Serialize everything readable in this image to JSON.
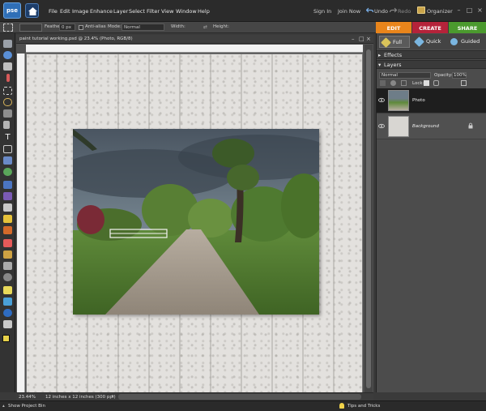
{
  "app": {
    "logo": "pse",
    "menus": [
      "File",
      "Edit",
      "Image",
      "Enhance",
      "Layer",
      "Select",
      "Filter",
      "View",
      "Window",
      "Help"
    ],
    "sign_in": "Sign In",
    "join_now": "Join Now",
    "undo": "Undo",
    "redo": "Redo",
    "organizer": "Organizer"
  },
  "options_bar": {
    "feather_label": "Feather:",
    "feather_value": "0 px",
    "antialias_label": "Anti-alias",
    "mode_label": "Mode:",
    "mode_value": "Normal",
    "width_label": "Width:",
    "height_label": "Height:"
  },
  "mode_tabs": {
    "edit": "EDIT",
    "create": "CREATE",
    "share": "SHARE"
  },
  "colors": {
    "edit": "#e9851b",
    "create": "#b5233a",
    "share": "#4b9a2e",
    "selected_layer": "#1e1e1e"
  },
  "document": {
    "title": "paint tutorial working.psd @ 23.4% (Photo, RGB/8)",
    "zoom": "23.44%",
    "doc_size": "12 inches x 12 inches (300 ppi)"
  },
  "panel": {
    "tabs": [
      "Full",
      "Quick",
      "Guided"
    ],
    "effects_header": "Effects",
    "layers_header": "Layers",
    "blend_mode": "Normal",
    "opacity_label": "Opacity:",
    "opacity_value": "100%",
    "lock_label": "Lock:",
    "layers": [
      {
        "name": "Photo",
        "selected": true
      },
      {
        "name": "Background",
        "selected": false
      }
    ]
  },
  "bottom": {
    "project_bin": "Show Project Bin",
    "tips": "Tips and Tricks"
  }
}
